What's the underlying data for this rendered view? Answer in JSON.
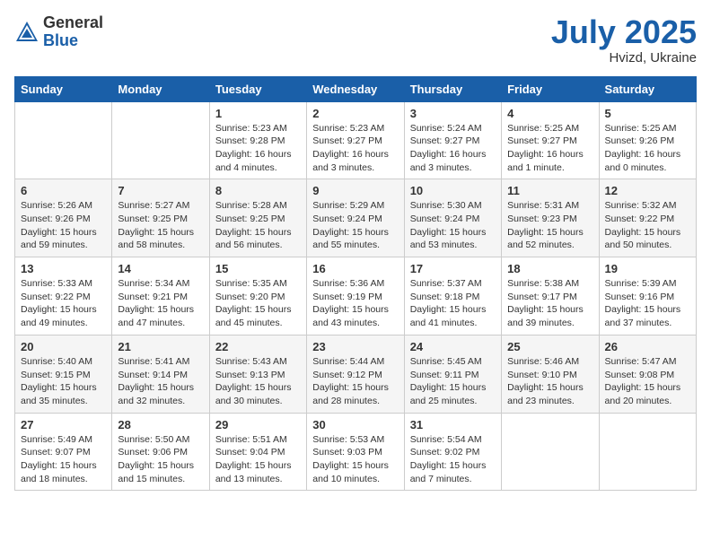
{
  "header": {
    "logo_general": "General",
    "logo_blue": "Blue",
    "month": "July 2025",
    "location": "Hvizd, Ukraine"
  },
  "days_of_week": [
    "Sunday",
    "Monday",
    "Tuesday",
    "Wednesday",
    "Thursday",
    "Friday",
    "Saturday"
  ],
  "weeks": [
    [
      {
        "day": "",
        "detail": ""
      },
      {
        "day": "",
        "detail": ""
      },
      {
        "day": "1",
        "detail": "Sunrise: 5:23 AM\nSunset: 9:28 PM\nDaylight: 16 hours\nand 4 minutes."
      },
      {
        "day": "2",
        "detail": "Sunrise: 5:23 AM\nSunset: 9:27 PM\nDaylight: 16 hours\nand 3 minutes."
      },
      {
        "day": "3",
        "detail": "Sunrise: 5:24 AM\nSunset: 9:27 PM\nDaylight: 16 hours\nand 3 minutes."
      },
      {
        "day": "4",
        "detail": "Sunrise: 5:25 AM\nSunset: 9:27 PM\nDaylight: 16 hours\nand 1 minute."
      },
      {
        "day": "5",
        "detail": "Sunrise: 5:25 AM\nSunset: 9:26 PM\nDaylight: 16 hours\nand 0 minutes."
      }
    ],
    [
      {
        "day": "6",
        "detail": "Sunrise: 5:26 AM\nSunset: 9:26 PM\nDaylight: 15 hours\nand 59 minutes."
      },
      {
        "day": "7",
        "detail": "Sunrise: 5:27 AM\nSunset: 9:25 PM\nDaylight: 15 hours\nand 58 minutes."
      },
      {
        "day": "8",
        "detail": "Sunrise: 5:28 AM\nSunset: 9:25 PM\nDaylight: 15 hours\nand 56 minutes."
      },
      {
        "day": "9",
        "detail": "Sunrise: 5:29 AM\nSunset: 9:24 PM\nDaylight: 15 hours\nand 55 minutes."
      },
      {
        "day": "10",
        "detail": "Sunrise: 5:30 AM\nSunset: 9:24 PM\nDaylight: 15 hours\nand 53 minutes."
      },
      {
        "day": "11",
        "detail": "Sunrise: 5:31 AM\nSunset: 9:23 PM\nDaylight: 15 hours\nand 52 minutes."
      },
      {
        "day": "12",
        "detail": "Sunrise: 5:32 AM\nSunset: 9:22 PM\nDaylight: 15 hours\nand 50 minutes."
      }
    ],
    [
      {
        "day": "13",
        "detail": "Sunrise: 5:33 AM\nSunset: 9:22 PM\nDaylight: 15 hours\nand 49 minutes."
      },
      {
        "day": "14",
        "detail": "Sunrise: 5:34 AM\nSunset: 9:21 PM\nDaylight: 15 hours\nand 47 minutes."
      },
      {
        "day": "15",
        "detail": "Sunrise: 5:35 AM\nSunset: 9:20 PM\nDaylight: 15 hours\nand 45 minutes."
      },
      {
        "day": "16",
        "detail": "Sunrise: 5:36 AM\nSunset: 9:19 PM\nDaylight: 15 hours\nand 43 minutes."
      },
      {
        "day": "17",
        "detail": "Sunrise: 5:37 AM\nSunset: 9:18 PM\nDaylight: 15 hours\nand 41 minutes."
      },
      {
        "day": "18",
        "detail": "Sunrise: 5:38 AM\nSunset: 9:17 PM\nDaylight: 15 hours\nand 39 minutes."
      },
      {
        "day": "19",
        "detail": "Sunrise: 5:39 AM\nSunset: 9:16 PM\nDaylight: 15 hours\nand 37 minutes."
      }
    ],
    [
      {
        "day": "20",
        "detail": "Sunrise: 5:40 AM\nSunset: 9:15 PM\nDaylight: 15 hours\nand 35 minutes."
      },
      {
        "day": "21",
        "detail": "Sunrise: 5:41 AM\nSunset: 9:14 PM\nDaylight: 15 hours\nand 32 minutes."
      },
      {
        "day": "22",
        "detail": "Sunrise: 5:43 AM\nSunset: 9:13 PM\nDaylight: 15 hours\nand 30 minutes."
      },
      {
        "day": "23",
        "detail": "Sunrise: 5:44 AM\nSunset: 9:12 PM\nDaylight: 15 hours\nand 28 minutes."
      },
      {
        "day": "24",
        "detail": "Sunrise: 5:45 AM\nSunset: 9:11 PM\nDaylight: 15 hours\nand 25 minutes."
      },
      {
        "day": "25",
        "detail": "Sunrise: 5:46 AM\nSunset: 9:10 PM\nDaylight: 15 hours\nand 23 minutes."
      },
      {
        "day": "26",
        "detail": "Sunrise: 5:47 AM\nSunset: 9:08 PM\nDaylight: 15 hours\nand 20 minutes."
      }
    ],
    [
      {
        "day": "27",
        "detail": "Sunrise: 5:49 AM\nSunset: 9:07 PM\nDaylight: 15 hours\nand 18 minutes."
      },
      {
        "day": "28",
        "detail": "Sunrise: 5:50 AM\nSunset: 9:06 PM\nDaylight: 15 hours\nand 15 minutes."
      },
      {
        "day": "29",
        "detail": "Sunrise: 5:51 AM\nSunset: 9:04 PM\nDaylight: 15 hours\nand 13 minutes."
      },
      {
        "day": "30",
        "detail": "Sunrise: 5:53 AM\nSunset: 9:03 PM\nDaylight: 15 hours\nand 10 minutes."
      },
      {
        "day": "31",
        "detail": "Sunrise: 5:54 AM\nSunset: 9:02 PM\nDaylight: 15 hours\nand 7 minutes."
      },
      {
        "day": "",
        "detail": ""
      },
      {
        "day": "",
        "detail": ""
      }
    ]
  ]
}
